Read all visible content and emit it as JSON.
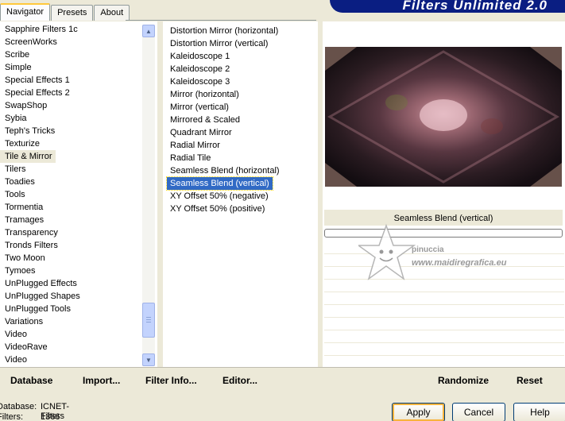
{
  "tabs": [
    "Navigator",
    "Presets",
    "About"
  ],
  "banner_title": "Filters Unlimited 2.0",
  "categories": [
    "Sapphire Filters 1c",
    "ScreenWorks",
    "Scribe",
    "Simple",
    "Special Effects 1",
    "Special Effects 2",
    "SwapShop",
    "Sybia",
    "Teph's Tricks",
    "Texturize",
    "Tile & Mirror",
    "Tilers",
    "Toadies",
    "Tools",
    "Tormentia",
    "Tramages",
    "Transparency",
    "Tronds Filters",
    "Two Moon",
    "Tymoes",
    "UnPlugged Effects",
    "UnPlugged Shapes",
    "UnPlugged Tools",
    "Variations",
    "Video",
    "VideoRave",
    "Video"
  ],
  "selected_category": "Tile & Mirror",
  "filters": [
    "Distortion Mirror (horizontal)",
    "Distortion Mirror (vertical)",
    "Kaleidoscope 1",
    "Kaleidoscope 2",
    "Kaleidoscope 3",
    "Mirror (horizontal)",
    "Mirror (vertical)",
    "Mirrored & Scaled",
    "Quadrant Mirror",
    "Radial Mirror",
    "Radial Tile",
    "Seamless Blend (horizontal)",
    "Seamless Blend (vertical)",
    "XY Offset 50% (negative)",
    "XY Offset 50% (positive)"
  ],
  "selected_filter": "Seamless Blend (vertical)",
  "preview_filter_name": "Seamless Blend (vertical)",
  "watermark": {
    "line1": "pinuccia",
    "line2": "www.maidiregrafica.eu"
  },
  "toolbar": {
    "database": "Database",
    "import": "Import...",
    "filter_info": "Filter Info...",
    "editor": "Editor...",
    "randomize": "Randomize",
    "reset": "Reset"
  },
  "status": {
    "database_label": "Database:",
    "database_value": "ICNET-Filters",
    "filters_label": "Filters:",
    "filters_value": "1366"
  },
  "buttons": {
    "apply": "Apply",
    "cancel": "Cancel",
    "help": "Help"
  },
  "colors": {
    "selection": "#316ac5",
    "banner": "#0a1e82",
    "face": "#ece9d8"
  }
}
